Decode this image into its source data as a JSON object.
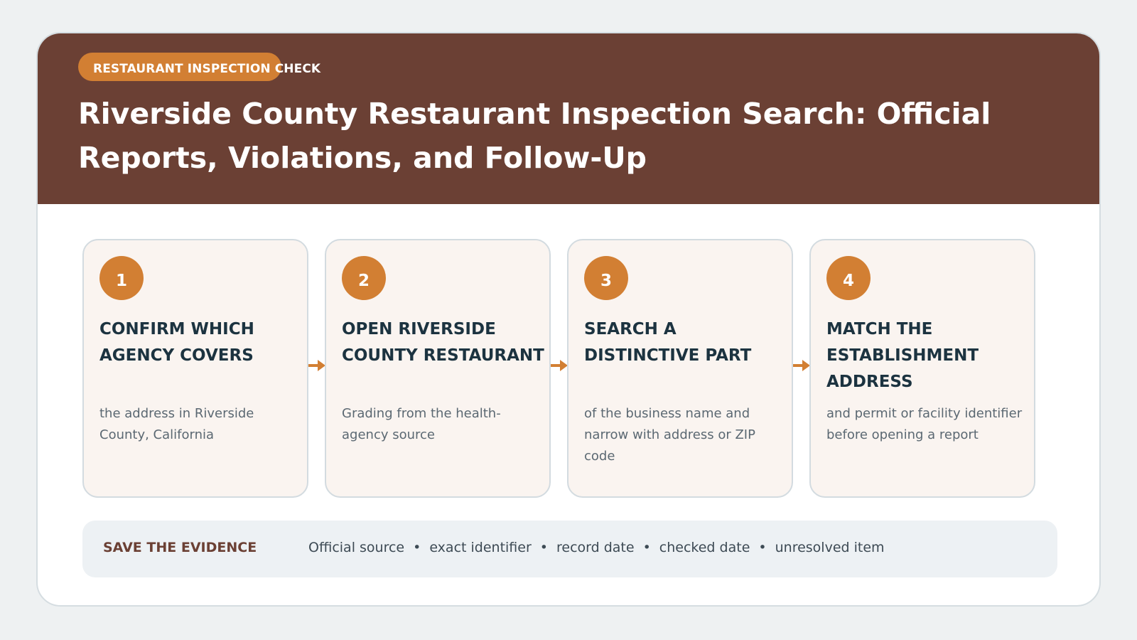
{
  "header": {
    "badge": "RESTAURANT INSPECTION CHECK",
    "title": "Riverside County Restaurant Inspection Search: Official Reports, Violations, and Follow-Up"
  },
  "steps": [
    {
      "number": "1",
      "title": "CONFIRM WHICH AGENCY COVERS",
      "description": "the address in Riverside County, California"
    },
    {
      "number": "2",
      "title": "OPEN RIVERSIDE COUNTY RESTAURANT",
      "description": "Grading from the health-agency source"
    },
    {
      "number": "3",
      "title": "SEARCH A DISTINCTIVE PART",
      "description": "of the business name and narrow with address or ZIP code"
    },
    {
      "number": "4",
      "title": "MATCH THE ESTABLISHMENT ADDRESS",
      "description": "and permit or facility identifier before opening a report"
    }
  ],
  "evidence": {
    "label": "SAVE THE EVIDENCE",
    "separator": "•",
    "items": [
      "Official source",
      "exact identifier",
      "record date",
      "checked date",
      "unresolved item"
    ]
  },
  "colors": {
    "header_bg": "#6b4034",
    "accent": "#d27f33",
    "card_bg": "#faf4f0",
    "heading_text": "#1c3340",
    "page_bg": "#eef1f2"
  },
  "icons": {
    "connector": "arrow-right-icon"
  }
}
